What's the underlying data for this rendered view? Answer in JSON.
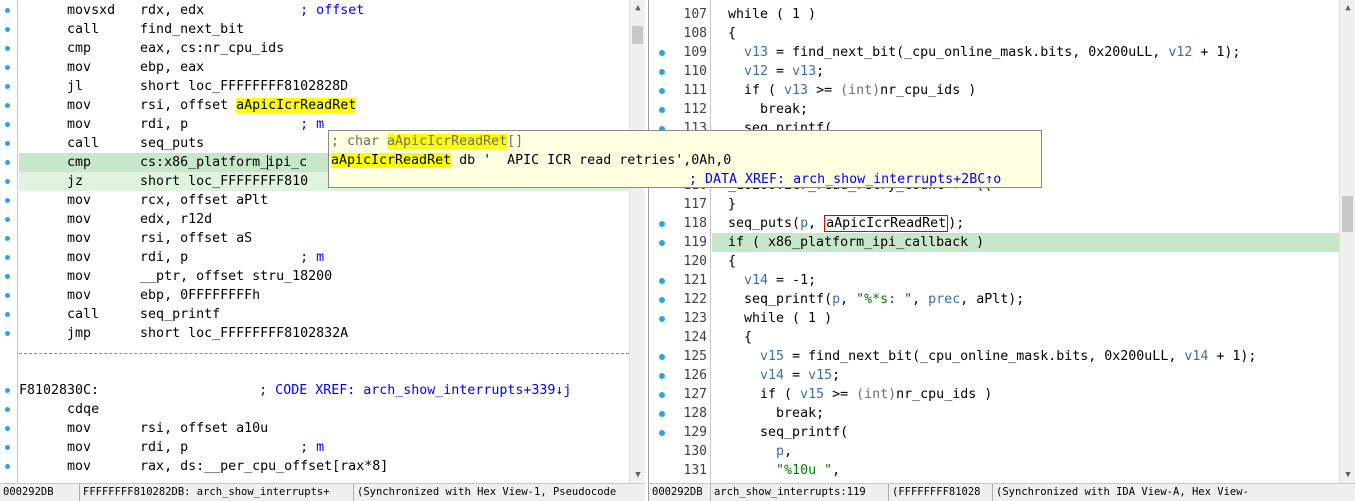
{
  "left": {
    "lines": [
      {
        "mnem": "movsxd",
        "ops": "rdx, edx",
        "cmt": "; offset"
      },
      {
        "mnem": "call",
        "ops": "find_next_bit",
        "cmt": ""
      },
      {
        "mnem": "cmp",
        "ops": "eax, cs:nr_cpu_ids",
        "cmt": ""
      },
      {
        "mnem": "mov",
        "ops": "ebp, eax",
        "cmt": ""
      },
      {
        "mnem": "jl",
        "ops": "short loc_FFFFFFFF8102828D",
        "cmt": ""
      },
      {
        "mnem": "mov",
        "ops_pre": "rsi, offset ",
        "ops_hl": "aApicIcrReadRet",
        "cmt": ""
      },
      {
        "mnem": "mov",
        "ops": "rdi, p",
        "cmt": "; m"
      },
      {
        "mnem": "call",
        "ops": "seq_puts",
        "cmt": ""
      },
      {
        "mnem": "cmp",
        "ops_pre": "cs:x86_platform_",
        "ops_post": "ipi_c",
        "cmt": ""
      },
      {
        "mnem": "jz",
        "ops": "short loc_FFFFFFFF810",
        "cmt": ""
      },
      {
        "mnem": "mov",
        "ops": "rcx, offset aPlt",
        "cmt": ""
      },
      {
        "mnem": "mov",
        "ops": "edx, r12d",
        "cmt": ""
      },
      {
        "mnem": "mov",
        "ops": "rsi, offset aS",
        "cmt": ""
      },
      {
        "mnem": "mov",
        "ops": "rdi, p",
        "cmt": "; m"
      },
      {
        "mnem": "mov",
        "ops": "__ptr, offset stru_18200",
        "cmt": ""
      },
      {
        "mnem": "mov",
        "ops": "ebp, 0FFFFFFFFh",
        "cmt": ""
      },
      {
        "mnem": "call",
        "ops": "seq_printf",
        "cmt": ""
      },
      {
        "mnem": "jmp",
        "ops": "short loc_FFFFFFFF8102832A",
        "cmt": ""
      }
    ],
    "label_line": {
      "label": "F8102830C:",
      "cmt": "; CODE XREF: arch_show_interrupts+339↓j"
    },
    "after": [
      {
        "mnem": "cdqe",
        "ops": "",
        "cmt": ""
      },
      {
        "mnem": "mov",
        "ops": "rsi, offset a10u",
        "cmt": ""
      },
      {
        "mnem": "mov",
        "ops": "rdi, p",
        "cmt": "; m"
      },
      {
        "mnem": "mov",
        "ops": "rax, ds:__per_cpu_offset[rax*8]",
        "cmt": ""
      }
    ],
    "status": [
      "000292DB",
      "FFFFFFFF810282DB: arch_show_interrupts+",
      "(Synchronized with Hex View-1, Pseudocode"
    ]
  },
  "tooltip": {
    "line1_prefix": "; char ",
    "line1_name": "aApicIcrReadRet",
    "line1_suffix": "[]",
    "line2_name": "aApicIcrReadRet",
    "line2_rest": " db '  APIC ICR read retries',0Ah,0",
    "line3": "; DATA XREF: arch_show_interrupts+2BC↑o"
  },
  "right": {
    "lines": [
      {
        "n": "107",
        "dot": false,
        "code": "while ( 1 )",
        "indent": 0
      },
      {
        "n": "108",
        "dot": false,
        "code": "{",
        "indent": 0
      },
      {
        "n": "109",
        "dot": true,
        "code": "v13 = find_next_bit(_cpu_online_mask.bits, 0x200uLL, v12 + 1);",
        "indent": 1
      },
      {
        "n": "110",
        "dot": true,
        "code": "v12 = v13;",
        "indent": 1
      },
      {
        "n": "111",
        "dot": true,
        "code": "if ( v13 >= (int)nr_cpu_ids )",
        "indent": 1
      },
      {
        "n": "112",
        "dot": true,
        "code": "break;",
        "indent": 2
      },
      {
        "n": "113",
        "dot": true,
        "code": "seq_printf(",
        "indent": 1
      },
      {
        "n": "114",
        "dot": false,
        "code": "",
        "indent": 0
      },
      {
        "n": "115",
        "dot": false,
        "code": "",
        "indent": 0
      },
      {
        "n": "116",
        "dot": false,
        "code": "_18200.icr_read_retry_count + *((",
        "indent": 0
      },
      {
        "n": "117",
        "dot": false,
        "code": "}",
        "indent": 0
      },
      {
        "n": "118",
        "dot": true,
        "code": "seq_puts(p, aApicIcrReadRet);",
        "indent": 0
      },
      {
        "n": "119",
        "dot": true,
        "code": "if ( x86_platform_ipi_callback )",
        "indent": 0
      },
      {
        "n": "120",
        "dot": false,
        "code": "{",
        "indent": 0
      },
      {
        "n": "121",
        "dot": true,
        "code": "v14 = -1;",
        "indent": 1
      },
      {
        "n": "122",
        "dot": true,
        "code": "seq_printf(p, \"%*s: \", prec, aPlt);",
        "indent": 1
      },
      {
        "n": "123",
        "dot": true,
        "code": "while ( 1 )",
        "indent": 1
      },
      {
        "n": "124",
        "dot": false,
        "code": "{",
        "indent": 1
      },
      {
        "n": "125",
        "dot": true,
        "code": "v15 = find_next_bit(_cpu_online_mask.bits, 0x200uLL, v14 + 1);",
        "indent": 2
      },
      {
        "n": "126",
        "dot": true,
        "code": "v14 = v15;",
        "indent": 2
      },
      {
        "n": "127",
        "dot": true,
        "code": "if ( v15 >= (int)nr_cpu_ids )",
        "indent": 2
      },
      {
        "n": "128",
        "dot": true,
        "code": "break;",
        "indent": 3
      },
      {
        "n": "129",
        "dot": true,
        "code": "seq_printf(",
        "indent": 2
      },
      {
        "n": "130",
        "dot": false,
        "code": "p,",
        "indent": 3
      },
      {
        "n": "131",
        "dot": false,
        "code": "\"%10u \",",
        "indent": 3
      }
    ],
    "status": [
      "000292DB",
      "arch_show_interrupts:119",
      "(FFFFFFFF81028",
      "(Synchronized with IDA View-A, Hex View-"
    ]
  },
  "colors": {
    "accent_dot": "#2aa3e8",
    "current_line": "#c8e6c9",
    "highlight": "#ffff00",
    "tooltip_bg": "#ffffe1"
  }
}
